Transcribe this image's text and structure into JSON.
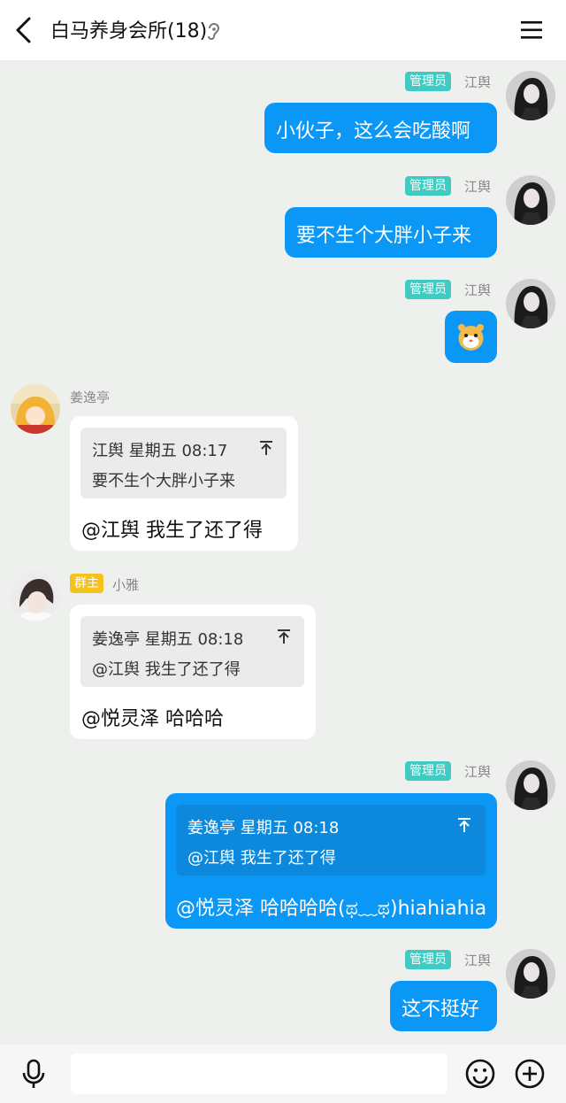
{
  "header": {
    "title": "白马养身会所(18)"
  },
  "messages": [
    {
      "id": 1,
      "direction": "out",
      "role_tag": "管理员",
      "sender": "江舆",
      "text": "小伙子，这么会吃酸啊"
    },
    {
      "id": 2,
      "direction": "out",
      "role_tag": "管理员",
      "sender": "江舆",
      "text": "要不生个大胖小子来"
    },
    {
      "id": 3,
      "direction": "out",
      "role_tag": "管理员",
      "sender": "江舆",
      "sticker": "hamster-emoji"
    },
    {
      "id": 4,
      "direction": "in",
      "sender": "姜逸亭",
      "quote": {
        "header": "江舆 星期五 08:17",
        "text": "要不生个大胖小子来"
      },
      "text": "@江舆 我生了还了得"
    },
    {
      "id": 5,
      "direction": "in",
      "role_tag": "群主",
      "sender": "小雅",
      "quote": {
        "header": "姜逸亭 星期五 08:18",
        "text": "@江舆 我生了还了得"
      },
      "text": "@悦灵泽 哈哈哈"
    },
    {
      "id": 6,
      "direction": "out",
      "role_tag": "管理员",
      "sender": "江舆",
      "quote": {
        "header": "姜逸亭 星期五 08:18",
        "text": "@江舆 我生了还了得"
      },
      "text": "@悦灵泽 哈哈哈哈(ಥ﹏ಥ)hiahiahia"
    },
    {
      "id": 7,
      "direction": "out",
      "role_tag": "管理员",
      "sender": "江舆",
      "text": "这不挺好"
    }
  ],
  "input": {
    "placeholder": ""
  },
  "colors": {
    "out_bubble": "#0a97f5",
    "admin_tag": "#3fcbc1",
    "owner_tag": "#f5c21c",
    "background": "#edf0ec"
  },
  "icons": [
    "back-arrow-icon",
    "ear-icon",
    "menu-icon",
    "microphone-icon",
    "emoji-icon",
    "plus-icon",
    "up-arrow-icon"
  ]
}
